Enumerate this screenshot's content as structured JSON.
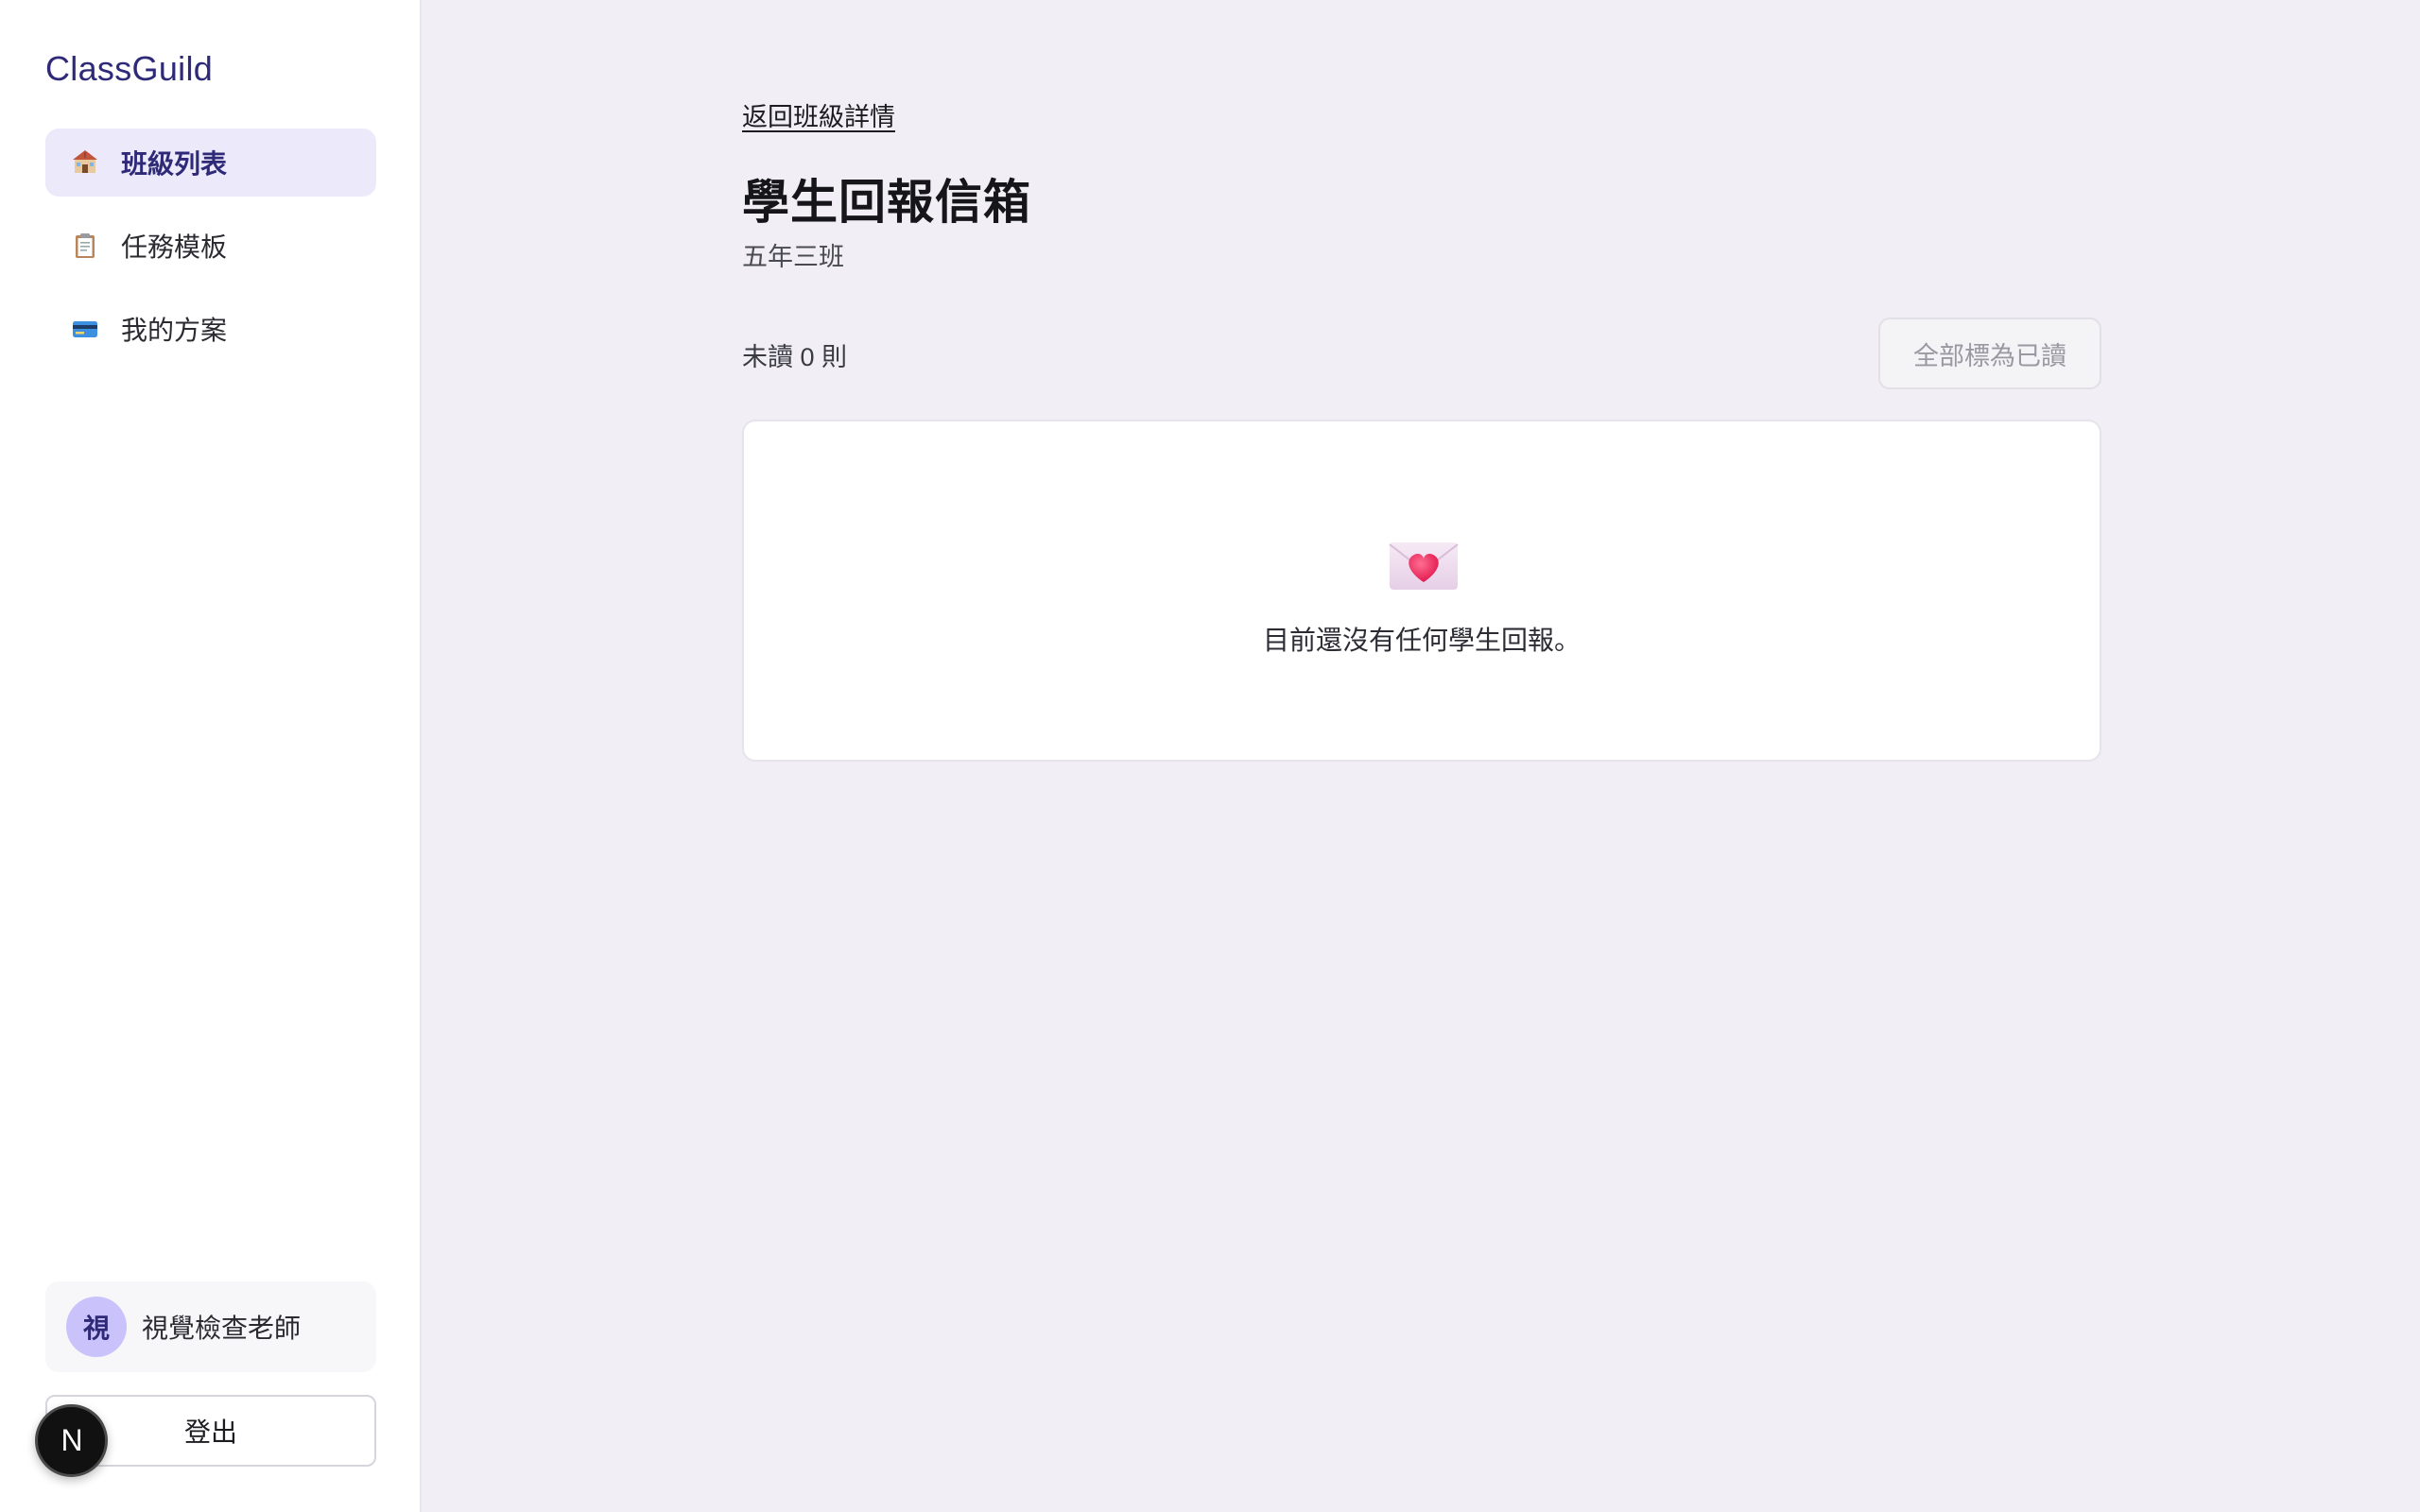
{
  "sidebar": {
    "brand": "ClassGuild",
    "items": [
      {
        "label": "班級列表",
        "icon": "school-icon",
        "active": true
      },
      {
        "label": "任務模板",
        "icon": "clipboard-icon",
        "active": false
      },
      {
        "label": "我的方案",
        "icon": "credit-card-icon",
        "active": false
      }
    ],
    "user": {
      "avatar_initial": "視",
      "name": "視覺檢查老師"
    },
    "logout_label": "登出"
  },
  "main": {
    "back_link": "返回班級詳情",
    "title": "學生回報信箱",
    "class_name": "五年三班",
    "unread_count": "未讀 0 則",
    "mark_all_read_label": "全部標為已讀",
    "empty_state": {
      "icon": "love-letter-icon",
      "text": "目前還沒有任何學生回報。"
    }
  },
  "dev_badge": {
    "label": "N",
    "icon": "next-logo-icon"
  },
  "colors": {
    "accent": "#2e2a78",
    "active_nav_bg": "#ece9fb",
    "avatar_bg": "#c9c2fb",
    "page_bg": "#f1eff5"
  }
}
